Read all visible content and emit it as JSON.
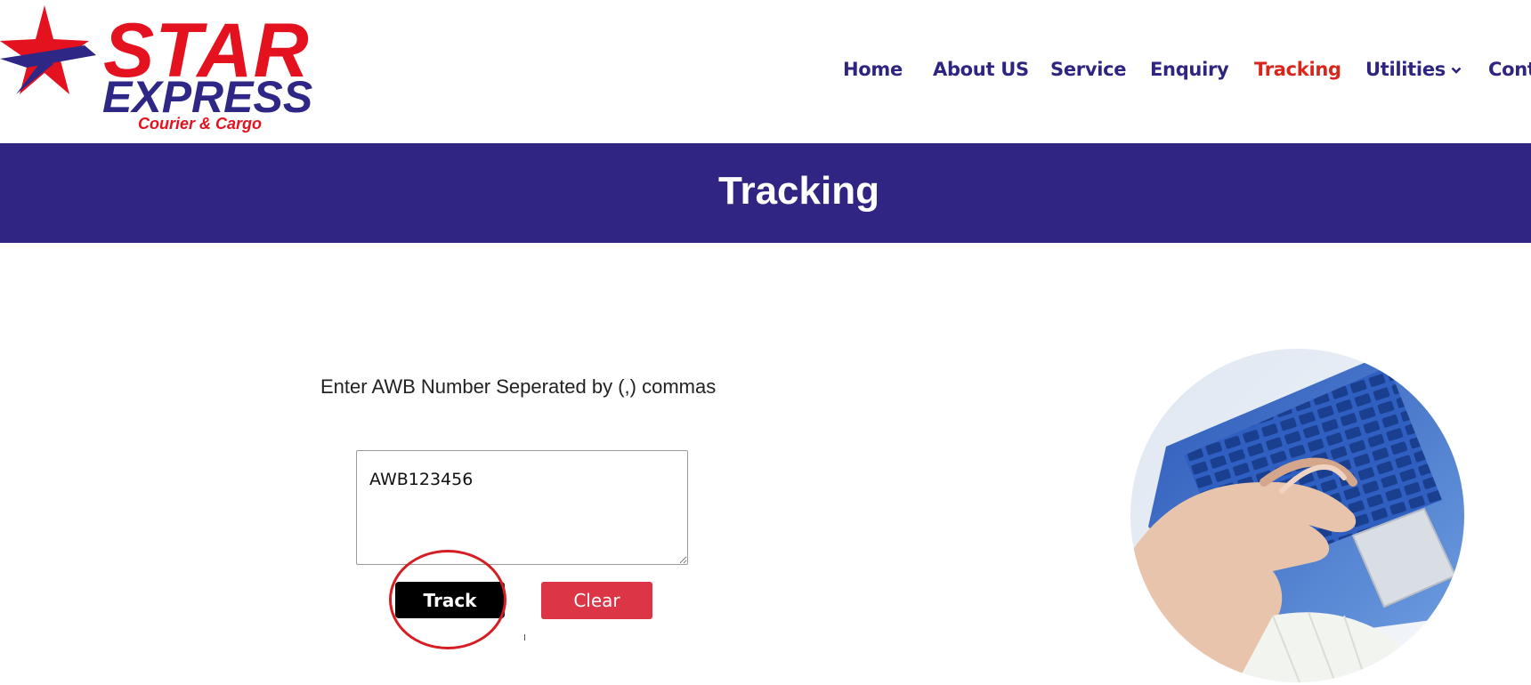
{
  "brand": {
    "name_line1": "STAR",
    "name_line2": "EXPRESS",
    "tagline": "Courier & Cargo",
    "colors": {
      "red": "#e4121f",
      "navy": "#2e2786"
    }
  },
  "nav": {
    "items": [
      {
        "label": "Home"
      },
      {
        "label": "About US"
      },
      {
        "label": "Service"
      },
      {
        "label": "Enquiry"
      },
      {
        "label": "Tracking"
      },
      {
        "label": "Utilities",
        "icon": "chevron-down-icon"
      },
      {
        "label": "Conta"
      }
    ],
    "active": "Tracking",
    "colors": {
      "default": "#2e2580",
      "active": "#d7261c"
    }
  },
  "banner": {
    "title": "Tracking",
    "background": "#302583"
  },
  "form": {
    "instruction": "Enter AWB Number Seperated by (,) commas",
    "awb_value": "AWB123456",
    "track_label": "Track",
    "clear_label": "Clear",
    "colors": {
      "track": "#000000",
      "clear": "#dc3545",
      "highlight_ring": "#d71d24"
    }
  },
  "photo": {
    "subject": "hand typing on laptop keyboard",
    "icon": "laptop-photo"
  }
}
